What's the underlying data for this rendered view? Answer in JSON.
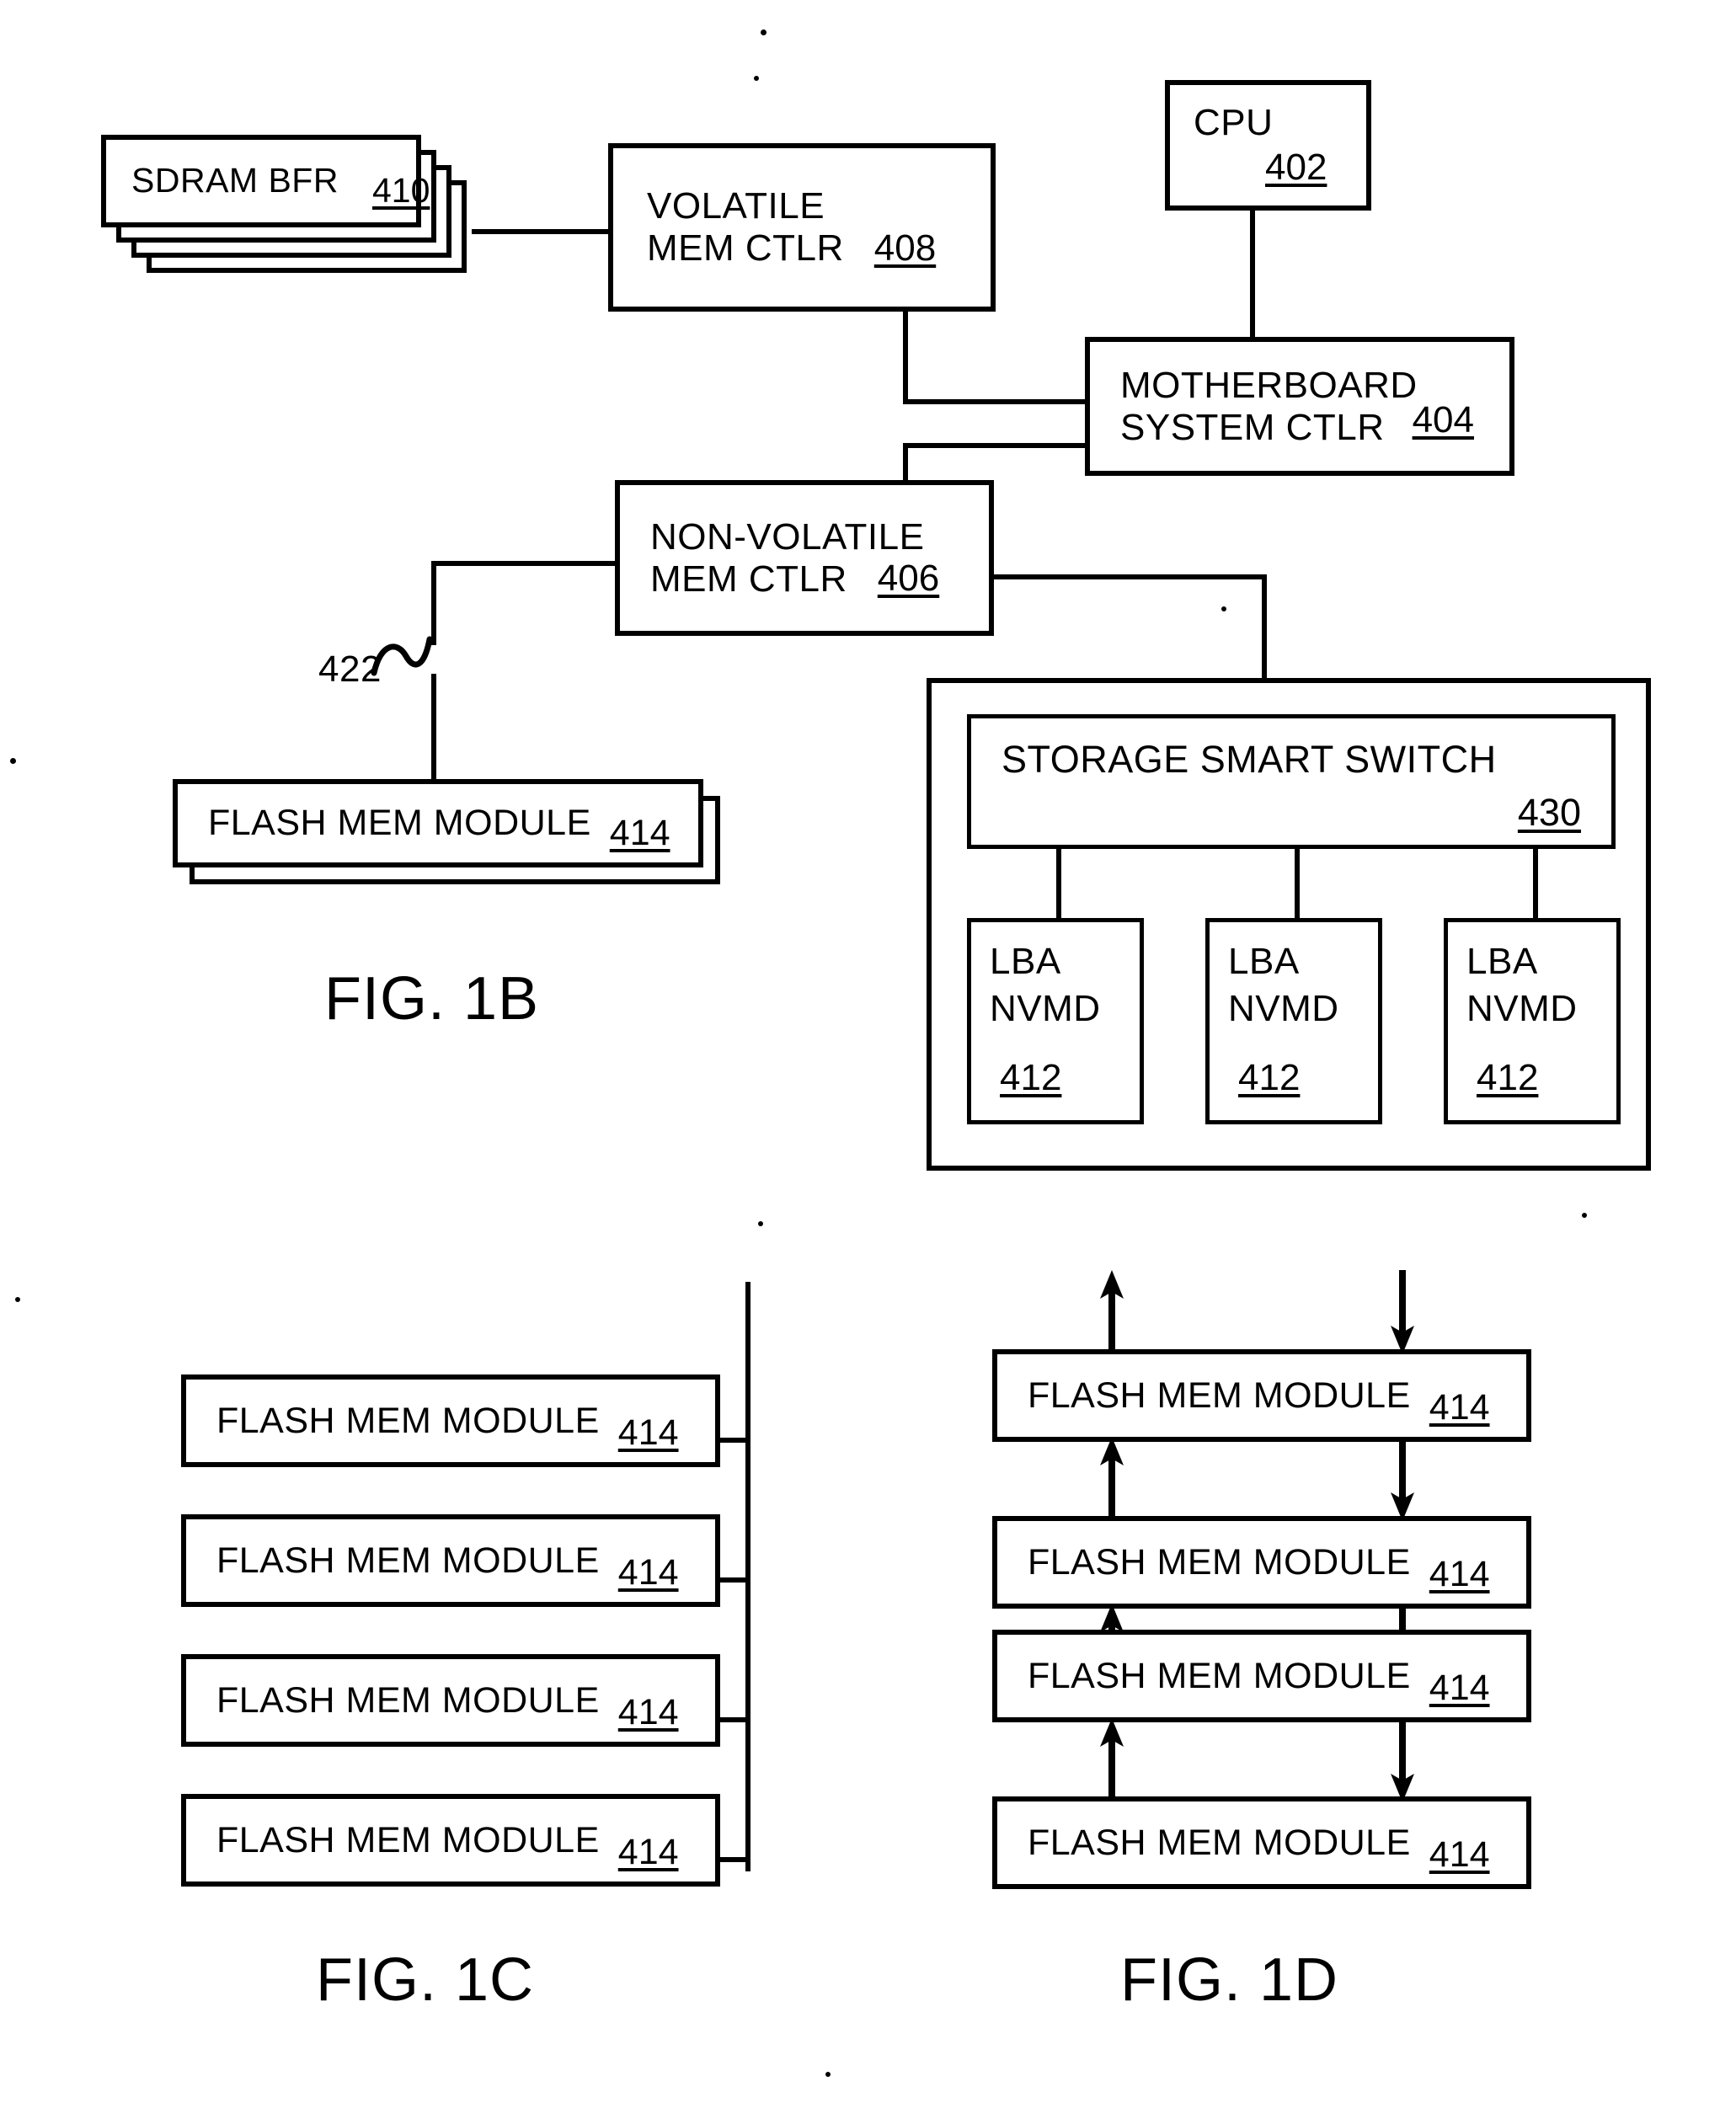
{
  "figures": {
    "fig1b": {
      "caption": "FIG. 1B",
      "blocks": {
        "sdram": {
          "label": "SDRAM  BFR",
          "ref": "410"
        },
        "volatile_ctlr": {
          "line1": "VOLATILE",
          "line2": "MEM CTLR",
          "ref": "408"
        },
        "cpu": {
          "label": "CPU",
          "ref": "402"
        },
        "motherboard": {
          "line1": "MOTHERBOARD",
          "line2": "SYSTEM CTLR",
          "ref": "404"
        },
        "nonvolatile_ctlr": {
          "line1": "NON-VOLATILE",
          "line2": "MEM CTLR",
          "ref": "406"
        },
        "flash_module": {
          "label": "FLASH MEM MODULE",
          "ref": "414"
        },
        "storage_smart_switch": {
          "label": "STORAGE SMART SWITCH",
          "ref": "430"
        },
        "lba_nvmd_1": {
          "line1": "LBA",
          "line2": "NVMD",
          "ref": "412"
        },
        "lba_nvmd_2": {
          "line1": "LBA",
          "line2": "NVMD",
          "ref": "412"
        },
        "lba_nvmd_3": {
          "line1": "LBA",
          "line2": "NVMD",
          "ref": "412"
        }
      },
      "bus_ref": "422"
    },
    "fig1c": {
      "caption": "FIG. 1C",
      "modules": [
        {
          "label": "FLASH MEM MODULE",
          "ref": "414"
        },
        {
          "label": "FLASH MEM MODULE",
          "ref": "414"
        },
        {
          "label": "FLASH MEM MODULE",
          "ref": "414"
        },
        {
          "label": "FLASH MEM MODULE",
          "ref": "414"
        }
      ]
    },
    "fig1d": {
      "caption": "FIG. 1D",
      "modules": [
        {
          "label": "FLASH MEM MODULE",
          "ref": "414"
        },
        {
          "label": "FLASH MEM MODULE",
          "ref": "414"
        },
        {
          "label": "FLASH MEM MODULE",
          "ref": "414"
        },
        {
          "label": "FLASH MEM MODULE",
          "ref": "414"
        }
      ]
    }
  },
  "colors": {
    "ink": "#000000",
    "paper": "#ffffff"
  }
}
